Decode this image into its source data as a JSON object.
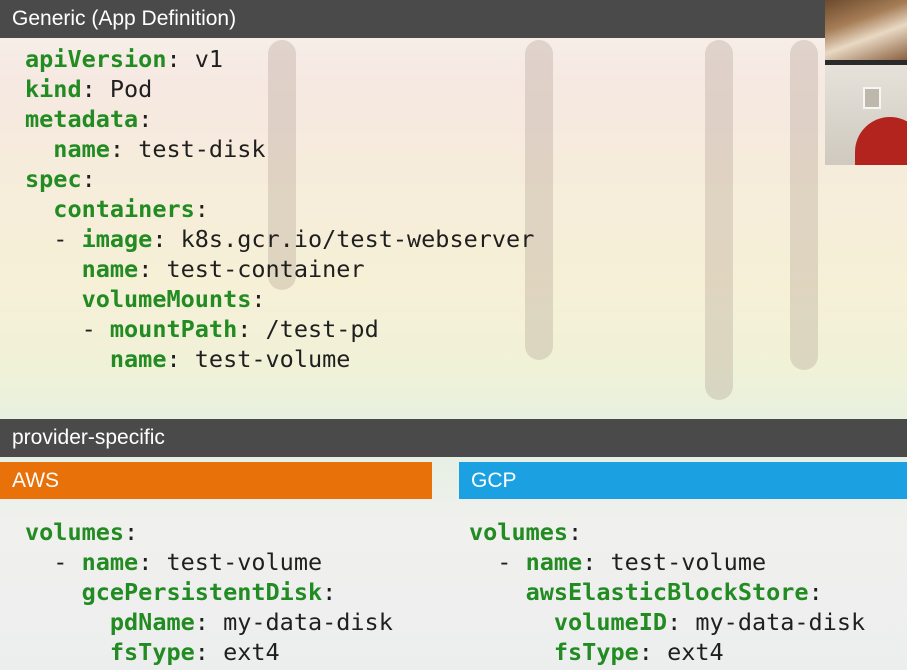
{
  "generic": {
    "title": "Generic (App Definition)",
    "code": [
      {
        "indent": "",
        "key": "apiVersion",
        "value": "v1"
      },
      {
        "indent": "",
        "key": "kind",
        "value": "Pod"
      },
      {
        "indent": "",
        "key": "metadata",
        "value": ""
      },
      {
        "indent": "  ",
        "key": "name",
        "value": "test-disk"
      },
      {
        "indent": "",
        "key": "spec",
        "value": ""
      },
      {
        "indent": "  ",
        "key": "containers",
        "value": ""
      },
      {
        "indent": "  - ",
        "key": "image",
        "value": "k8s.gcr.io/test-webserver"
      },
      {
        "indent": "    ",
        "key": "name",
        "value": "test-container"
      },
      {
        "indent": "    ",
        "key": "volumeMounts",
        "value": ""
      },
      {
        "indent": "    - ",
        "key": "mountPath",
        "value": "/test-pd"
      },
      {
        "indent": "      ",
        "key": "name",
        "value": "test-volume"
      }
    ]
  },
  "provider": {
    "title": "provider-specific",
    "aws": {
      "label": "AWS",
      "code": [
        {
          "indent": "",
          "key": "volumes",
          "value": ""
        },
        {
          "indent": "  - ",
          "key": "name",
          "value": "test-volume"
        },
        {
          "indent": "    ",
          "key": "gcePersistentDisk",
          "value": ""
        },
        {
          "indent": "      ",
          "key": "pdName",
          "value": "my-data-disk"
        },
        {
          "indent": "      ",
          "key": "fsType",
          "value": "ext4"
        }
      ]
    },
    "gcp": {
      "label": "GCP",
      "code": [
        {
          "indent": "",
          "key": "volumes",
          "value": ""
        },
        {
          "indent": "  - ",
          "key": "name",
          "value": "test-volume"
        },
        {
          "indent": "    ",
          "key": "awsElasticBlockStore",
          "value": ""
        },
        {
          "indent": "      ",
          "key": "volumeID",
          "value": "my-data-disk"
        },
        {
          "indent": "      ",
          "key": "fsType",
          "value": "ext4"
        }
      ]
    }
  },
  "colors": {
    "header_bar": "#4a4a4a",
    "aws": "#e8710a",
    "gcp": "#1ba1e2",
    "yaml_key": "#228b22"
  }
}
